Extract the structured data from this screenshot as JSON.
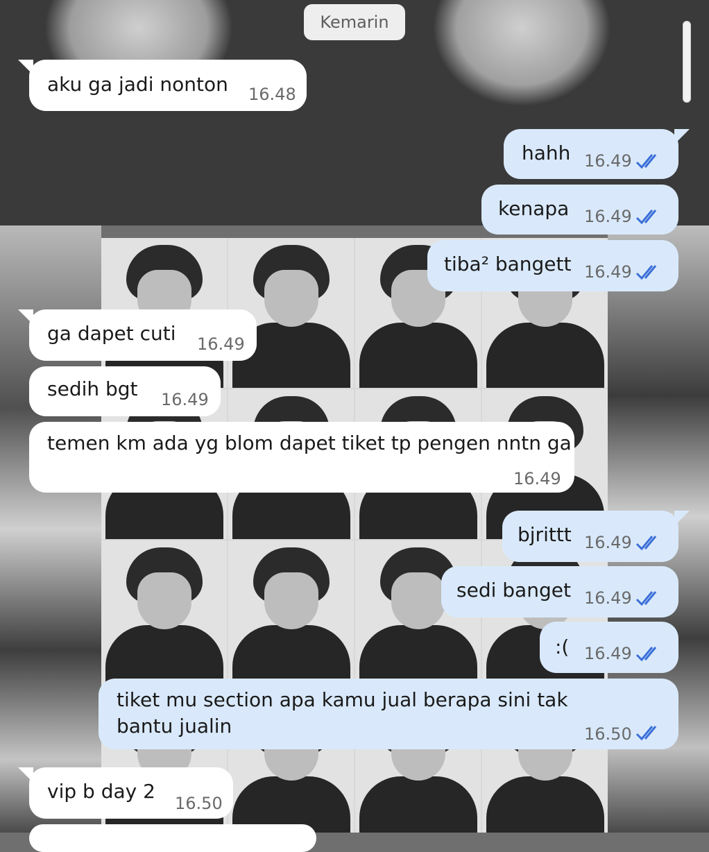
{
  "date_label": "Kemarin",
  "messages": [
    {
      "dir": "in",
      "text": "aku ga jadi nonton",
      "time": "16.48"
    },
    {
      "dir": "out",
      "text": "hahh",
      "time": "16.49",
      "status": "read"
    },
    {
      "dir": "out",
      "text": "kenapa",
      "time": "16.49",
      "status": "read"
    },
    {
      "dir": "out",
      "text": "tiba² bangett",
      "time": "16.49",
      "status": "read"
    },
    {
      "dir": "in",
      "text": "ga dapet cuti",
      "time": "16.49"
    },
    {
      "dir": "in",
      "text": "sedih bgt",
      "time": "16.49"
    },
    {
      "dir": "in",
      "text": "temen km ada yg blom dapet tiket tp pengen nntn ga",
      "time": "16.49"
    },
    {
      "dir": "out",
      "text": "bjrittt",
      "time": "16.49",
      "status": "read"
    },
    {
      "dir": "out",
      "text": "sedi banget",
      "time": "16.49",
      "status": "read"
    },
    {
      "dir": "out",
      "text": ":(",
      "time": "16.49",
      "status": "read"
    },
    {
      "dir": "out",
      "text": "tiket mu section apa kamu jual berapa sini tak bantu jualin",
      "time": "16.50",
      "status": "read"
    },
    {
      "dir": "in",
      "text": "vip b day 2",
      "time": "16.50"
    }
  ],
  "icons": {
    "read_receipt": "double-check-icon"
  },
  "colors": {
    "incoming_bubble": "#ffffff",
    "outgoing_bubble": "#d9e9fb",
    "read_ticks": "#3b6fd8"
  }
}
